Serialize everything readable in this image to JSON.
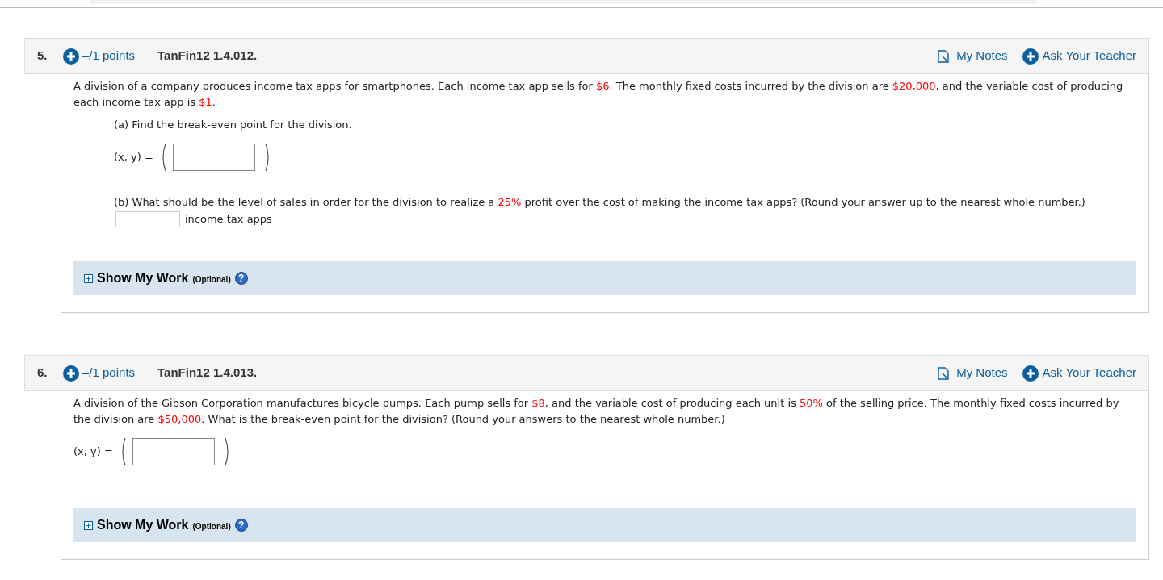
{
  "questions": [
    {
      "number": "5.",
      "points": "–/1 points",
      "code": "TanFin12 1.4.012.",
      "notes": "My Notes",
      "ask": "Ask Your Teacher",
      "parts": [
        {
          "kind": "paragraph",
          "segments": [
            {
              "text": "A division of a company produces income tax apps for smartphones. Each income tax app sells for ",
              "highlight": false
            },
            {
              "text": "$6",
              "highlight": true
            },
            {
              "text": ". The monthly fixed costs incurred by the division are ",
              "highlight": false
            },
            {
              "text": "$20,000",
              "highlight": true
            },
            {
              "text": ", and the variable cost of producing each income tax app is ",
              "highlight": false
            },
            {
              "text": "$1",
              "highlight": true
            },
            {
              "text": ".",
              "highlight": false
            }
          ]
        },
        {
          "kind": "subparagraph",
          "segments": [
            {
              "text": "(a) Find the break-even point for the division.",
              "highlight": false
            }
          ]
        },
        {
          "kind": "point",
          "label": "(x, y) ="
        },
        {
          "kind": "subparagraph",
          "segments": [
            {
              "text": "(b) What should be the level of sales in order for the division to realize a ",
              "highlight": false
            },
            {
              "text": "25%",
              "highlight": true
            },
            {
              "text": " profit over the cost of making the income tax apps? (Round your answer up to the nearest whole number.)",
              "highlight": false
            }
          ]
        },
        {
          "kind": "answer",
          "unit": "income tax apps"
        }
      ],
      "work": {
        "title": "Show My Work",
        "optional": "(Optional)",
        "help": "?"
      }
    },
    {
      "number": "6.",
      "points": "–/1 points",
      "code": "TanFin12 1.4.013.",
      "notes": "My Notes",
      "ask": "Ask Your Teacher",
      "parts": [
        {
          "kind": "paragraph",
          "segments": [
            {
              "text": "A division of the Gibson Corporation manufactures bicycle pumps. Each pump sells for ",
              "highlight": false
            },
            {
              "text": "$8",
              "highlight": true
            },
            {
              "text": ", and the variable cost of producing each unit is ",
              "highlight": false
            },
            {
              "text": "50%",
              "highlight": true
            },
            {
              "text": " of the selling price. The monthly fixed costs incurred by the division are ",
              "highlight": false
            },
            {
              "text": "$50,000",
              "highlight": true
            },
            {
              "text": ". What is the break-even point for the division? (Round your answers to the nearest whole number.)",
              "highlight": false
            }
          ]
        },
        {
          "kind": "point_flat",
          "label": "(x, y) ="
        }
      ],
      "work": {
        "title": "Show My Work",
        "optional": "(Optional)",
        "help": "?"
      }
    }
  ]
}
